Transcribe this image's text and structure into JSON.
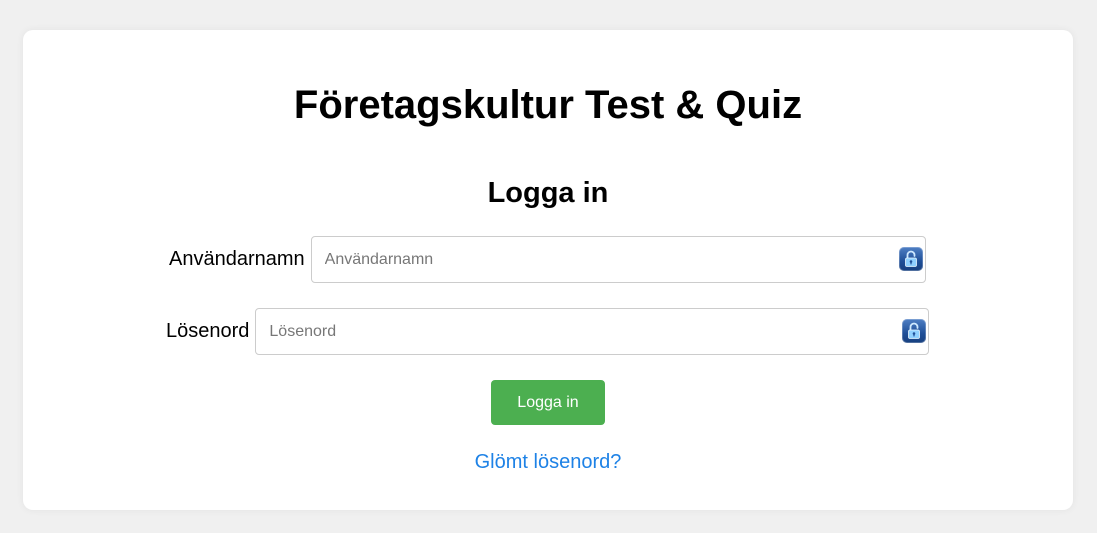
{
  "page": {
    "title": "Företagskultur Test & Quiz",
    "subtitle": "Logga in"
  },
  "form": {
    "username": {
      "label": "Användarnamn",
      "placeholder": "Användarnamn",
      "value": "",
      "icon": "lock-open-icon"
    },
    "password": {
      "label": "Lösenord",
      "placeholder": "Lösenord",
      "value": "",
      "icon": "lock-open-icon"
    },
    "submit_label": "Logga in",
    "forgot_link": "Glömt lösenord?"
  },
  "colors": {
    "background": "#f0f0f0",
    "card": "#ffffff",
    "button": "#4caf50",
    "link": "#1e82e6",
    "lock_icon": "#1f4f98"
  }
}
